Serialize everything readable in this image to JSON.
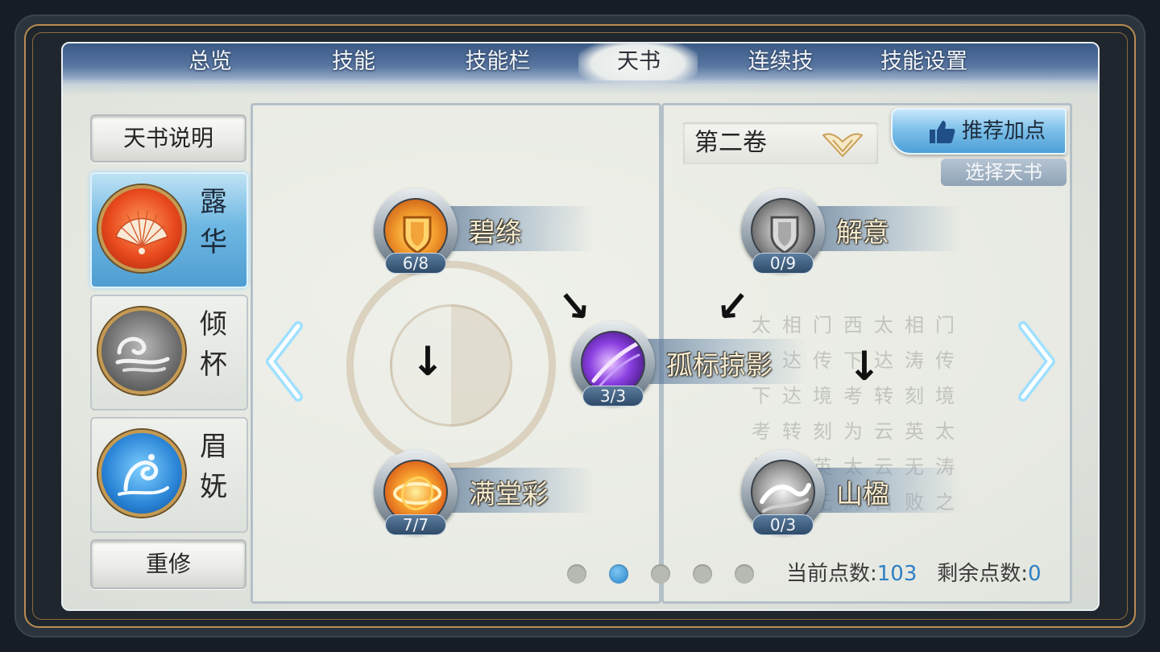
{
  "tabs": [
    {
      "label": "总览"
    },
    {
      "label": "技能"
    },
    {
      "label": "技能栏"
    },
    {
      "label": "天书",
      "active": true
    },
    {
      "label": "连续技"
    },
    {
      "label": "技能设置"
    }
  ],
  "sidebar": {
    "explain_label": "天书说明",
    "books": [
      {
        "name": "露华",
        "icon": "folding-fan-icon",
        "selected": true
      },
      {
        "name": "倾杯",
        "icon": "cloud-swirl-icon",
        "selected": false
      },
      {
        "name": "眉妩",
        "icon": "phoenix-icon",
        "selected": false
      }
    ],
    "reset_label": "重修"
  },
  "volume": {
    "label": "第二卷",
    "icon": "lotus-dropdown-icon"
  },
  "recommend_label": "推荐加点",
  "select_book_label": "选择天书",
  "skills": [
    {
      "name": "碧绦",
      "count": "6/8",
      "icon": "fire-shield-icon"
    },
    {
      "name": "满堂彩",
      "count": "7/7",
      "icon": "fire-swirl-icon"
    },
    {
      "name": "孤标掠影",
      "count": "3/3",
      "icon": "purple-slash-icon"
    },
    {
      "name": "解意",
      "count": "0/9",
      "icon": "grey-shield-icon"
    },
    {
      "name": "山楹",
      "count": "0/3",
      "icon": "grey-wave-icon"
    }
  ],
  "calligraphy": "太相门西太相门西达传下达涛传下达境考转刻境考转刻为云英太为云英太云无涛登闪无涛自败之",
  "pager": {
    "total": 5,
    "active": 1
  },
  "points": {
    "current_label": "当前点数:",
    "current_value": "103",
    "remaining_label": "剩余点数:",
    "remaining_value": "0"
  },
  "colors": {
    "accent_blue": "#4d9fd6",
    "gold_frame": "#b98d52",
    "points_value": "#2f7fc4"
  }
}
